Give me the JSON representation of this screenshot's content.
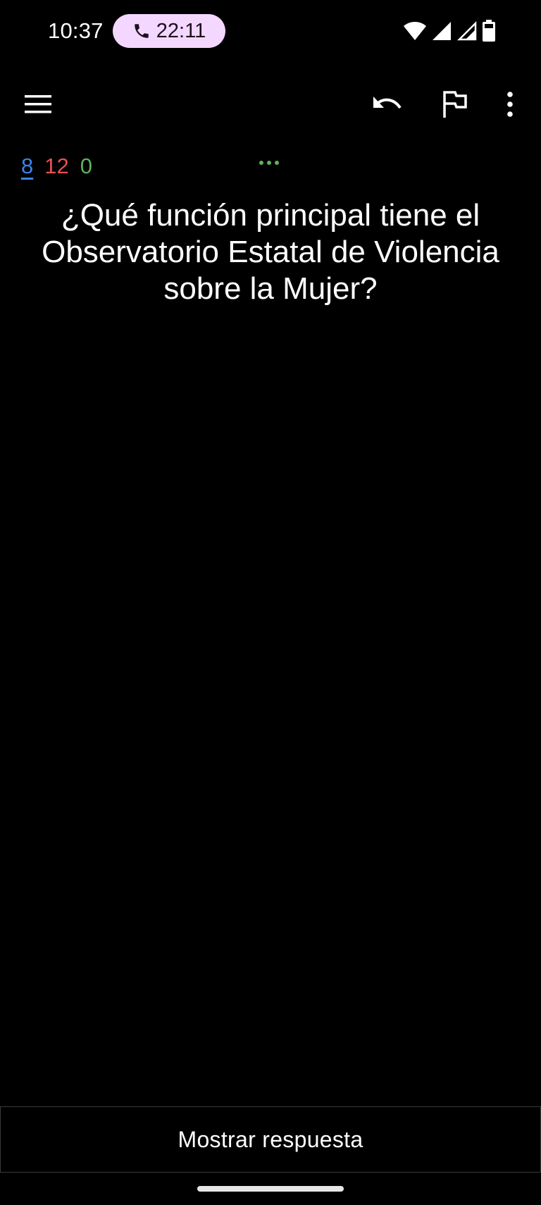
{
  "status_bar": {
    "time": "10:37",
    "call_duration": "22:11",
    "icons": [
      "phone-icon",
      "wifi-icon",
      "signal-icon",
      "signal-icon",
      "battery-icon"
    ]
  },
  "toolbar": {
    "icons": [
      "menu-icon",
      "undo-icon",
      "flag-icon",
      "more-vert-icon"
    ]
  },
  "counts": {
    "new": "8",
    "learning": "12",
    "review": "0",
    "colors": {
      "new": "#3d82e8",
      "learning": "#e45252",
      "review": "#5fb25f"
    }
  },
  "card": {
    "question": "¿Qué función principal tiene el Observatorio Estatal de Violencia sobre la Mujer?"
  },
  "actions": {
    "show_answer_label": "Mostrar respuesta"
  },
  "colors": {
    "background": "#000000",
    "call_pill": "#f4d7ff"
  }
}
